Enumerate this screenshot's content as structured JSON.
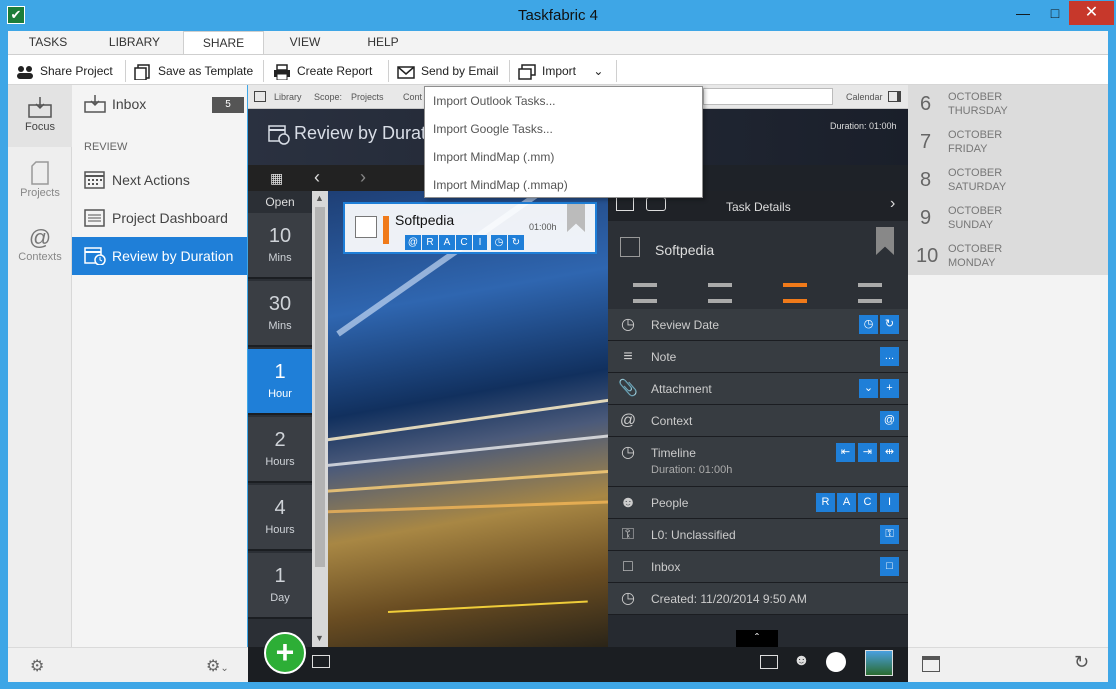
{
  "window": {
    "title": "Taskfabric 4"
  },
  "ribbon": {
    "tabs": [
      "TASKS",
      "LIBRARY",
      "SHARE",
      "VIEW",
      "HELP"
    ],
    "active_tab": "SHARE",
    "buttons": {
      "share_project": "Share Project",
      "save_template": "Save as Template",
      "create_report": "Create Report",
      "send_email": "Send by Email",
      "import": "Import"
    }
  },
  "import_menu": {
    "items": [
      "Import Outlook Tasks...",
      "Import Google Tasks...",
      "Import MindMap (.mm)",
      "Import MindMap (.mmap)"
    ]
  },
  "leftnav": {
    "focus": "Focus",
    "projects": "Projects",
    "contexts": "Contexts"
  },
  "sidebar": {
    "inbox_label": "Inbox",
    "inbox_count": "5",
    "review_heading": "REVIEW",
    "items": [
      "Next Actions",
      "Project Dashboard",
      "Review by Duration"
    ],
    "active_item": "Review by Duration"
  },
  "filterbar": {
    "library": "Library",
    "scope": "Scope:",
    "projects": "Projects",
    "cont": "Cont",
    "calendar": "Calendar"
  },
  "main": {
    "title": "Review by Duration",
    "duration_top": "Duration: 01:00h",
    "open_label": "Open",
    "durations": [
      {
        "n": "10",
        "u": "Mins"
      },
      {
        "n": "30",
        "u": "Mins"
      },
      {
        "n": "1",
        "u": "Hour"
      },
      {
        "n": "2",
        "u": "Hours"
      },
      {
        "n": "4",
        "u": "Hours"
      },
      {
        "n": "1",
        "u": "Day"
      }
    ],
    "active_duration_index": 2
  },
  "taskcard": {
    "title": "Softpedia",
    "duration": "01:00h",
    "raci": [
      "@",
      "R",
      "A",
      "C",
      "I"
    ]
  },
  "details": {
    "header": "Task Details",
    "task_name": "Softpedia",
    "rows": {
      "review_date": "Review Date",
      "note": "Note",
      "attachment": "Attachment",
      "context": "Context",
      "timeline": "Timeline",
      "timeline_sub": "Duration: 01:00h",
      "people": "People",
      "classification": "L0: Unclassified",
      "inbox": "Inbox",
      "created": "Created: 11/20/2014 9:50 AM"
    },
    "people_raci": [
      "R",
      "A",
      "C",
      "I"
    ],
    "note_btn": "...",
    "context_btn": "@"
  },
  "calendar": {
    "days": [
      {
        "num": "6",
        "month": "OCTOBER",
        "dow": "THURSDAY"
      },
      {
        "num": "7",
        "month": "OCTOBER",
        "dow": "FRIDAY"
      },
      {
        "num": "8",
        "month": "OCTOBER",
        "dow": "SATURDAY"
      },
      {
        "num": "9",
        "month": "OCTOBER",
        "dow": "SUNDAY"
      },
      {
        "num": "10",
        "month": "OCTOBER",
        "dow": "MONDAY"
      }
    ]
  },
  "colors": {
    "accent": "#1f7fd8",
    "add": "#2dae36",
    "priority": "#f07a1a",
    "frame": "#3ea6e6"
  }
}
